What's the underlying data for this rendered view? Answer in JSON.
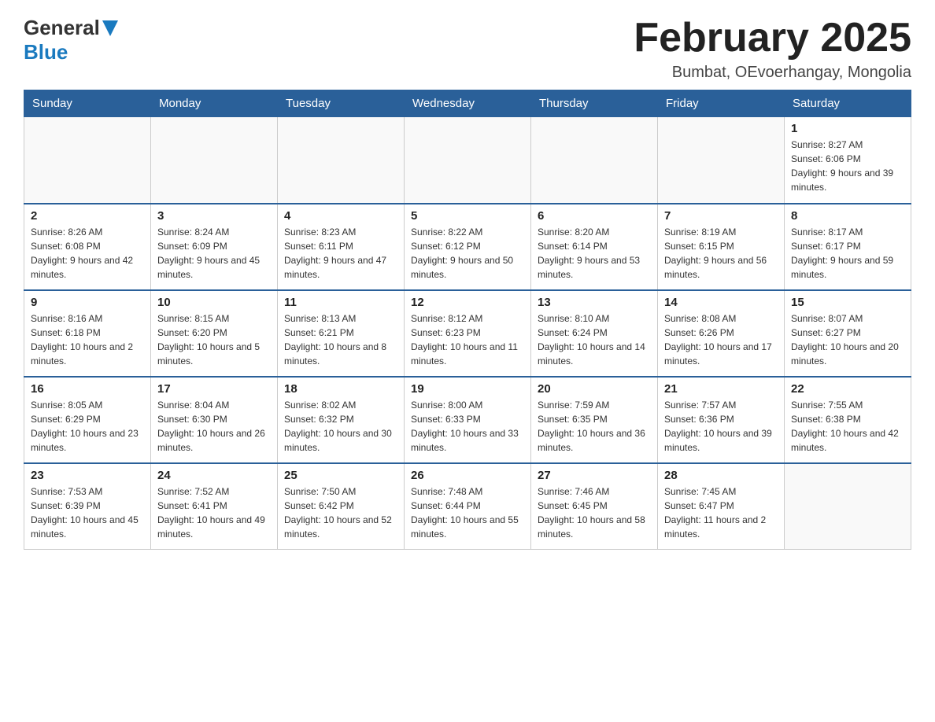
{
  "header": {
    "logo_general": "General",
    "logo_blue": "Blue",
    "month_title": "February 2025",
    "location": "Bumbat, OEvoerhangay, Mongolia"
  },
  "days_of_week": [
    "Sunday",
    "Monday",
    "Tuesday",
    "Wednesday",
    "Thursday",
    "Friday",
    "Saturday"
  ],
  "weeks": [
    {
      "days": [
        {
          "num": "",
          "info": ""
        },
        {
          "num": "",
          "info": ""
        },
        {
          "num": "",
          "info": ""
        },
        {
          "num": "",
          "info": ""
        },
        {
          "num": "",
          "info": ""
        },
        {
          "num": "",
          "info": ""
        },
        {
          "num": "1",
          "info": "Sunrise: 8:27 AM\nSunset: 6:06 PM\nDaylight: 9 hours and 39 minutes."
        }
      ]
    },
    {
      "days": [
        {
          "num": "2",
          "info": "Sunrise: 8:26 AM\nSunset: 6:08 PM\nDaylight: 9 hours and 42 minutes."
        },
        {
          "num": "3",
          "info": "Sunrise: 8:24 AM\nSunset: 6:09 PM\nDaylight: 9 hours and 45 minutes."
        },
        {
          "num": "4",
          "info": "Sunrise: 8:23 AM\nSunset: 6:11 PM\nDaylight: 9 hours and 47 minutes."
        },
        {
          "num": "5",
          "info": "Sunrise: 8:22 AM\nSunset: 6:12 PM\nDaylight: 9 hours and 50 minutes."
        },
        {
          "num": "6",
          "info": "Sunrise: 8:20 AM\nSunset: 6:14 PM\nDaylight: 9 hours and 53 minutes."
        },
        {
          "num": "7",
          "info": "Sunrise: 8:19 AM\nSunset: 6:15 PM\nDaylight: 9 hours and 56 minutes."
        },
        {
          "num": "8",
          "info": "Sunrise: 8:17 AM\nSunset: 6:17 PM\nDaylight: 9 hours and 59 minutes."
        }
      ]
    },
    {
      "days": [
        {
          "num": "9",
          "info": "Sunrise: 8:16 AM\nSunset: 6:18 PM\nDaylight: 10 hours and 2 minutes."
        },
        {
          "num": "10",
          "info": "Sunrise: 8:15 AM\nSunset: 6:20 PM\nDaylight: 10 hours and 5 minutes."
        },
        {
          "num": "11",
          "info": "Sunrise: 8:13 AM\nSunset: 6:21 PM\nDaylight: 10 hours and 8 minutes."
        },
        {
          "num": "12",
          "info": "Sunrise: 8:12 AM\nSunset: 6:23 PM\nDaylight: 10 hours and 11 minutes."
        },
        {
          "num": "13",
          "info": "Sunrise: 8:10 AM\nSunset: 6:24 PM\nDaylight: 10 hours and 14 minutes."
        },
        {
          "num": "14",
          "info": "Sunrise: 8:08 AM\nSunset: 6:26 PM\nDaylight: 10 hours and 17 minutes."
        },
        {
          "num": "15",
          "info": "Sunrise: 8:07 AM\nSunset: 6:27 PM\nDaylight: 10 hours and 20 minutes."
        }
      ]
    },
    {
      "days": [
        {
          "num": "16",
          "info": "Sunrise: 8:05 AM\nSunset: 6:29 PM\nDaylight: 10 hours and 23 minutes."
        },
        {
          "num": "17",
          "info": "Sunrise: 8:04 AM\nSunset: 6:30 PM\nDaylight: 10 hours and 26 minutes."
        },
        {
          "num": "18",
          "info": "Sunrise: 8:02 AM\nSunset: 6:32 PM\nDaylight: 10 hours and 30 minutes."
        },
        {
          "num": "19",
          "info": "Sunrise: 8:00 AM\nSunset: 6:33 PM\nDaylight: 10 hours and 33 minutes."
        },
        {
          "num": "20",
          "info": "Sunrise: 7:59 AM\nSunset: 6:35 PM\nDaylight: 10 hours and 36 minutes."
        },
        {
          "num": "21",
          "info": "Sunrise: 7:57 AM\nSunset: 6:36 PM\nDaylight: 10 hours and 39 minutes."
        },
        {
          "num": "22",
          "info": "Sunrise: 7:55 AM\nSunset: 6:38 PM\nDaylight: 10 hours and 42 minutes."
        }
      ]
    },
    {
      "days": [
        {
          "num": "23",
          "info": "Sunrise: 7:53 AM\nSunset: 6:39 PM\nDaylight: 10 hours and 45 minutes."
        },
        {
          "num": "24",
          "info": "Sunrise: 7:52 AM\nSunset: 6:41 PM\nDaylight: 10 hours and 49 minutes."
        },
        {
          "num": "25",
          "info": "Sunrise: 7:50 AM\nSunset: 6:42 PM\nDaylight: 10 hours and 52 minutes."
        },
        {
          "num": "26",
          "info": "Sunrise: 7:48 AM\nSunset: 6:44 PM\nDaylight: 10 hours and 55 minutes."
        },
        {
          "num": "27",
          "info": "Sunrise: 7:46 AM\nSunset: 6:45 PM\nDaylight: 10 hours and 58 minutes."
        },
        {
          "num": "28",
          "info": "Sunrise: 7:45 AM\nSunset: 6:47 PM\nDaylight: 11 hours and 2 minutes."
        },
        {
          "num": "",
          "info": ""
        }
      ]
    }
  ]
}
